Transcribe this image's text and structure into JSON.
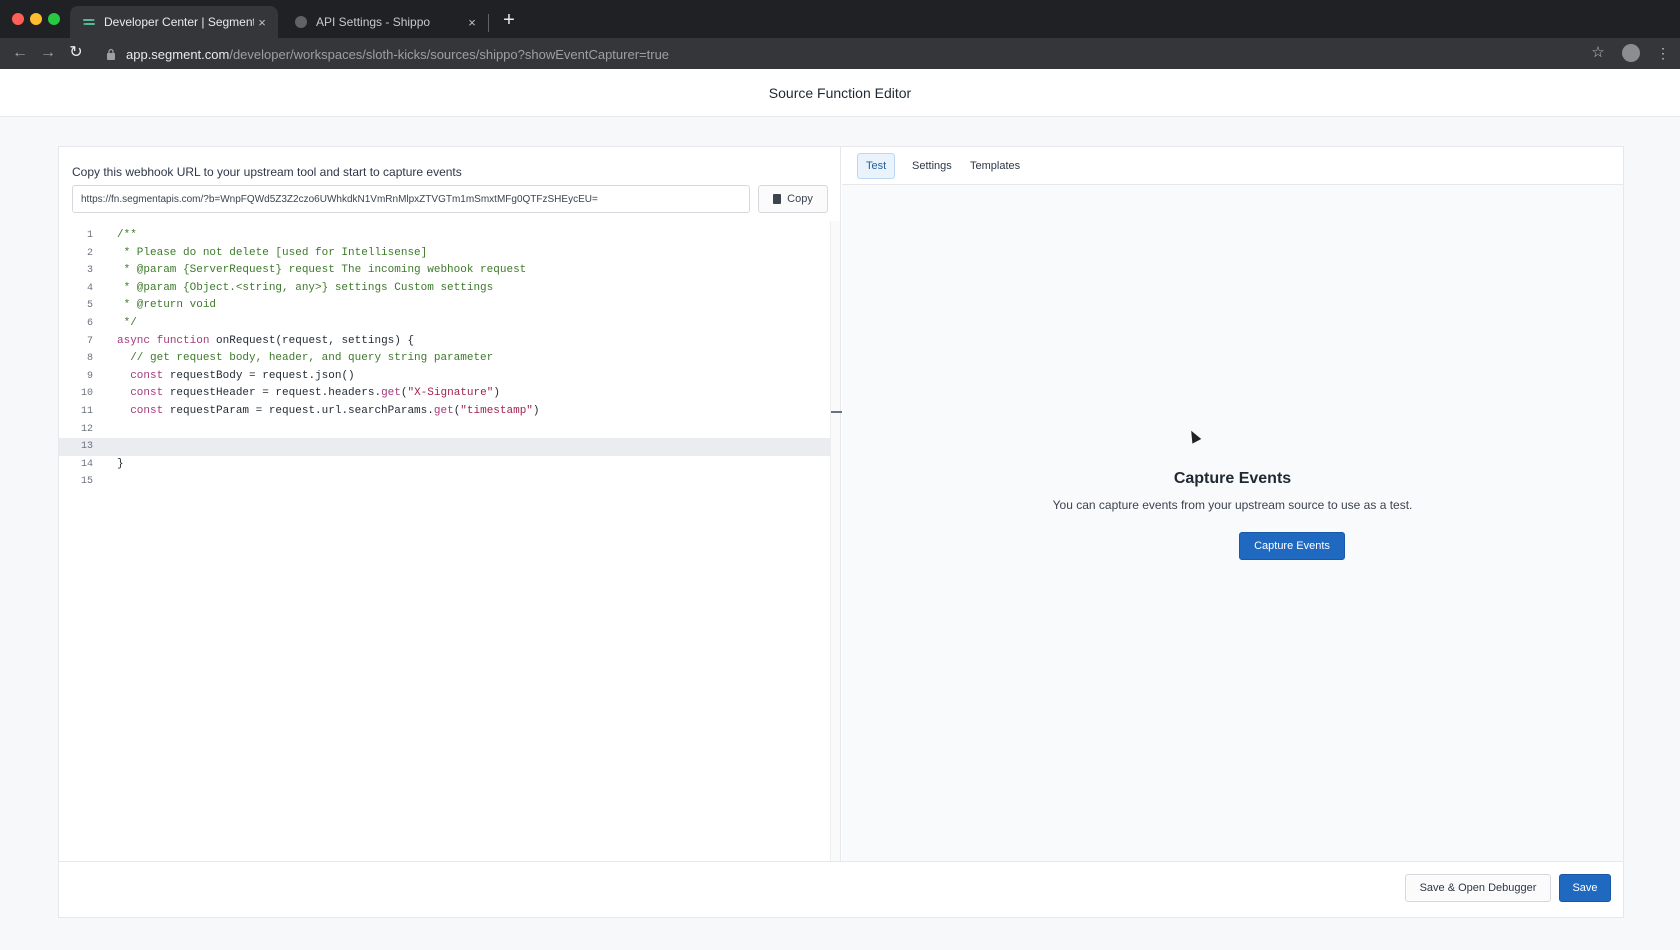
{
  "browser": {
    "tabs": [
      {
        "title": "Developer Center | Segment",
        "active": true,
        "icon": "segment-logo-icon"
      },
      {
        "title": "API Settings - Shippo",
        "active": false,
        "icon": "shippo-logo-icon"
      }
    ],
    "url": {
      "host": "app.segment.com",
      "path": "/developer/workspaces/sloth-kicks/sources/shippo?showEventCapturer=true"
    },
    "close_glyph": "×",
    "new_tab_glyph": "+",
    "back_glyph": "←",
    "forward_glyph": "→",
    "reload_glyph": "↻",
    "star_glyph": "☆",
    "menu_glyph": "⋮",
    "lock_glyph": "🔒"
  },
  "page": {
    "title": "Source Function Editor"
  },
  "editor": {
    "webhook_label": "Copy this webhook URL to your upstream tool and start to capture events",
    "webhook_url": "https://fn.segmentapis.com/?b=WnpFQWd5Z3Z2czo6UWhkdkN1VmRnMlpxZTVGTm1mSmxtMFg0QTFzSHEycEU=",
    "copy_label": "Copy",
    "lines": [
      {
        "n": "1",
        "text": "/**",
        "kind": "comment"
      },
      {
        "n": "2",
        "text": " * Please do not delete [used for Intellisense]",
        "kind": "comment"
      },
      {
        "n": "3",
        "text": " * @param {ServerRequest} request The incoming webhook request",
        "kind": "comment"
      },
      {
        "n": "4",
        "text": " * @param {Object.<string, any>} settings Custom settings",
        "kind": "comment"
      },
      {
        "n": "5",
        "text": " * @return void",
        "kind": "comment"
      },
      {
        "n": "6",
        "text": " */",
        "kind": "comment"
      },
      {
        "n": "7",
        "text": "async function onRequest(request, settings) {",
        "kind": "code"
      },
      {
        "n": "8",
        "text": "  // get request body, header, and query string parameter",
        "kind": "comment"
      },
      {
        "n": "9",
        "text": "  const requestBody = request.json()",
        "kind": "code"
      },
      {
        "n": "10",
        "text": "  const requestHeader = request.headers.get(\"X-Signature\")",
        "kind": "code"
      },
      {
        "n": "11",
        "text": "  const requestParam = request.url.searchParams.get(\"timestamp\")",
        "kind": "code"
      },
      {
        "n": "12",
        "text": "",
        "kind": "code"
      },
      {
        "n": "13",
        "text": "",
        "kind": "code"
      },
      {
        "n": "14",
        "text": "}",
        "kind": "code"
      },
      {
        "n": "15",
        "text": "",
        "kind": "code"
      }
    ]
  },
  "right_panel": {
    "tabs": [
      "Test",
      "Settings",
      "Templates"
    ],
    "capture_title": "Capture Events",
    "capture_desc": "You can capture events from your upstream source to use as a test.",
    "capture_button": "Capture Events"
  },
  "footer": {
    "save_debug_label": "Save & Open Debugger",
    "save_label": "Save"
  },
  "colors": {
    "primary": "#1f69c1",
    "comment": "#3d7a2b",
    "keyword": "#a53a7d",
    "string": "#a3244c"
  }
}
